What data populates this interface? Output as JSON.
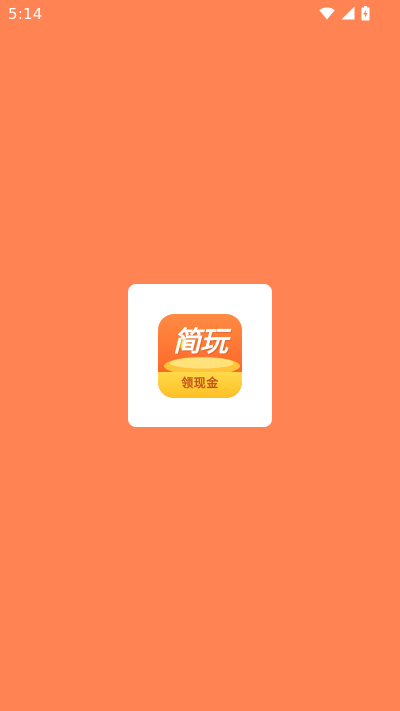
{
  "status_bar": {
    "time": "5:14",
    "icons": [
      "wifi-icon",
      "cell-signal-icon",
      "battery-charging-icon"
    ]
  },
  "splash": {
    "background_color": "#FF8353",
    "card_color": "#FFFFFF",
    "app_icon": {
      "title_text": "简玩",
      "banner_text": "领现金",
      "colors": {
        "top": "#FF8B44",
        "bottom": "#F05A1C",
        "banner": "#FFC024",
        "banner_text": "#C0561A",
        "coin": "#FFD23F"
      }
    }
  }
}
